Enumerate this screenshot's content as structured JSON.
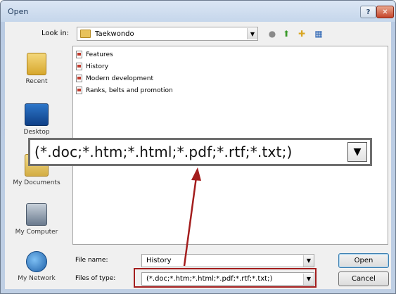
{
  "window": {
    "title": "Open"
  },
  "lookin": {
    "label": "Look in:",
    "value": "Taekwondo"
  },
  "places": {
    "recent": "Recent",
    "desktop": "Desktop",
    "docs": "My Documents",
    "computer": "My Computer",
    "network": "My Network"
  },
  "files": [
    "Features",
    "History",
    "Modern development",
    "Ranks, belts and promotion"
  ],
  "filename": {
    "label": "File name:",
    "value": "History"
  },
  "filetype": {
    "label": "Files of type:",
    "value": "(*.doc;*.htm;*.html;*.pdf;*.rtf;*.txt;)"
  },
  "buttons": {
    "open": "Open",
    "cancel": "Cancel"
  },
  "callout": {
    "text": "(*.doc;*.htm;*.html;*.pdf;*.rtf;*.txt;)"
  },
  "colors": {
    "highlight": "#a31d1d",
    "accent": "#3c7fb1"
  }
}
